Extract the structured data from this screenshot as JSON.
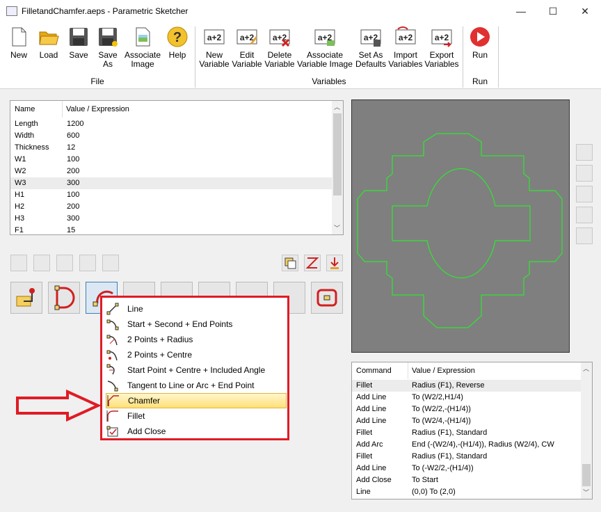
{
  "window": {
    "title": "FilletandChamfer.aeps - Parametric Sketcher",
    "minimize": "—",
    "maximize": "☐",
    "close": "✕"
  },
  "ribbon": {
    "file_buttons": [
      {
        "label": "New",
        "icon": "new-file-icon"
      },
      {
        "label": "Load",
        "icon": "folder-open-icon"
      },
      {
        "label": "Save",
        "icon": "floppy-disk-icon"
      },
      {
        "label": "Save\nAs",
        "icon": "save-as-icon"
      },
      {
        "label": "Associate\nImage",
        "icon": "image-icon"
      },
      {
        "label": "Help",
        "icon": "help-icon"
      }
    ],
    "variable_buttons": [
      {
        "label": "New\nVariable",
        "icon": "new-variable-icon"
      },
      {
        "label": "Edit\nVariable",
        "icon": "edit-variable-icon"
      },
      {
        "label": "Delete\nVariable",
        "icon": "delete-variable-icon"
      },
      {
        "label": "Associate\nVariable Image",
        "icon": "variable-image-icon"
      },
      {
        "label": "Set As\nDefaults",
        "icon": "set-defaults-icon"
      },
      {
        "label": "Import\nVariables",
        "icon": "import-variables-icon"
      },
      {
        "label": "Export\nVariables",
        "icon": "export-variables-icon"
      }
    ],
    "run_button": {
      "label": "Run",
      "icon": "run-icon"
    },
    "groups": {
      "file": "File",
      "variables": "Variables",
      "run": "Run"
    }
  },
  "variables": {
    "headers": [
      "Name",
      "Value / Expression"
    ],
    "rows": [
      [
        "Length",
        "1200"
      ],
      [
        "Width",
        "600"
      ],
      [
        "Thickness",
        "12"
      ],
      [
        "W1",
        "100"
      ],
      [
        "W2",
        "200"
      ],
      [
        "W3",
        "300"
      ],
      [
        "H1",
        "100"
      ],
      [
        "H2",
        "200"
      ],
      [
        "H3",
        "300"
      ],
      [
        "F1",
        "15"
      ]
    ],
    "selected_row": 5
  },
  "dropdown": {
    "items": [
      {
        "label": "Line",
        "icon": "line-icon"
      },
      {
        "label": "Start + Second + End Points",
        "icon": "three-point-arc-icon"
      },
      {
        "label": "2 Points + Radius",
        "icon": "radius-arc-icon"
      },
      {
        "label": "2 Points + Centre",
        "icon": "centre-arc-icon"
      },
      {
        "label": "Start Point + Centre + Included Angle",
        "icon": "angle-arc-icon"
      },
      {
        "label": "Tangent to Line or Arc + End Point",
        "icon": "tangent-arc-icon"
      },
      {
        "label": "Chamfer",
        "icon": "chamfer-icon"
      },
      {
        "label": "Fillet",
        "icon": "fillet-icon"
      },
      {
        "label": "Add Close",
        "icon": "add-close-icon"
      }
    ],
    "highlighted": 6
  },
  "commands": {
    "headers": [
      "Command",
      "Value / Expression"
    ],
    "rows": [
      [
        "Fillet",
        "Radius (F1), Reverse"
      ],
      [
        "Add Line",
        "To (W2/2,H1/4)"
      ],
      [
        "Add Line",
        "To (W2/2,-(H1/4))"
      ],
      [
        "Add Line",
        "To (W2/4,-(H1/4))"
      ],
      [
        "Fillet",
        "Radius (F1), Standard"
      ],
      [
        "Add Arc",
        "End (-(W2/4),-(H1/4)), Radius (W2/4), CW"
      ],
      [
        "Fillet",
        "Radius (F1), Standard"
      ],
      [
        "Add Line",
        "To (-W2/2,-(H1/4))"
      ],
      [
        "Add Close",
        "To Start"
      ],
      [
        "Line",
        "(0,0) To (2,0)"
      ]
    ],
    "selected_row": 0
  },
  "colors": {
    "accent_red": "#e01b24",
    "preview_bg": "#7f7f7f",
    "sketch_line": "#2ee82e",
    "run_red": "#e03030"
  }
}
